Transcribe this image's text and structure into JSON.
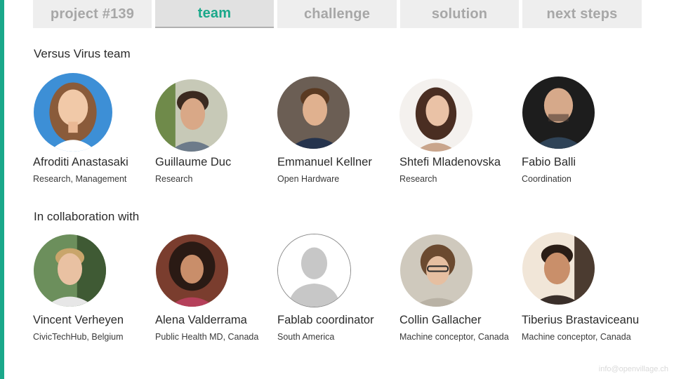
{
  "tabs": [
    {
      "label": "project #139",
      "active": false
    },
    {
      "label": "team",
      "active": true
    },
    {
      "label": "challenge",
      "active": false
    },
    {
      "label": "solution",
      "active": false
    },
    {
      "label": "next steps",
      "active": false
    }
  ],
  "section1": {
    "title": "Versus Virus team",
    "members": [
      {
        "name": "Afroditi Anastasaki",
        "role": "Research, Management",
        "avatar": "photo-avatar"
      },
      {
        "name": "Guillaume Duc",
        "role": "Research",
        "avatar": "photo-avatar"
      },
      {
        "name": "Emmanuel Kellner",
        "role": "Open Hardware",
        "avatar": "photo-avatar"
      },
      {
        "name": "Shtefi Mladenovska",
        "role": "Research",
        "avatar": "photo-avatar"
      },
      {
        "name": "Fabio Balli",
        "role": "Coordination",
        "avatar": "photo-avatar"
      }
    ]
  },
  "section2": {
    "title": "In collaboration with",
    "members": [
      {
        "name": "Vincent Verheyen",
        "role": "CivicTechHub, Belgium",
        "avatar": "photo-avatar"
      },
      {
        "name": "Alena Valderrama",
        "role": "Public Health MD, Canada",
        "avatar": "photo-avatar"
      },
      {
        "name": "Fablab coordinator",
        "role": "South America",
        "avatar": "placeholder-avatar-icon"
      },
      {
        "name": "Collin Gallacher",
        "role": "Machine conceptor, Canada",
        "avatar": "photo-avatar"
      },
      {
        "name": "Tiberius Brastaviceanu",
        "role": "Machine conceptor, Canada",
        "avatar": "photo-avatar"
      }
    ]
  },
  "footer": {
    "email": "info@openvillage.ch"
  },
  "colors": {
    "accent": "#1aa88a",
    "tab_bg": "#eeeeee",
    "tab_active_bg": "#e1e1e1",
    "tab_text": "#a7a7a7"
  }
}
